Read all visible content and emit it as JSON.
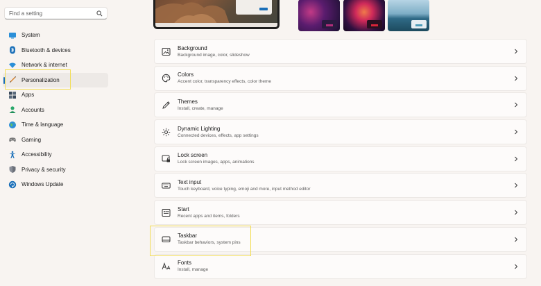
{
  "search": {
    "placeholder": "Find a setting"
  },
  "sidebar": {
    "items": [
      {
        "label": "System",
        "icon": "monitor-icon"
      },
      {
        "label": "Bluetooth & devices",
        "icon": "bluetooth-icon"
      },
      {
        "label": "Network & internet",
        "icon": "wifi-icon"
      },
      {
        "label": "Personalization",
        "icon": "brush-icon",
        "active": true
      },
      {
        "label": "Apps",
        "icon": "apps-icon"
      },
      {
        "label": "Accounts",
        "icon": "person-icon"
      },
      {
        "label": "Time & language",
        "icon": "globe-icon"
      },
      {
        "label": "Gaming",
        "icon": "gamepad-icon"
      },
      {
        "label": "Accessibility",
        "icon": "accessibility-icon"
      },
      {
        "label": "Privacy & security",
        "icon": "shield-icon"
      },
      {
        "label": "Windows Update",
        "icon": "update-icon"
      }
    ]
  },
  "cards": [
    {
      "title": "Background",
      "subtitle": "Background image, color, slideshow",
      "icon": "image-icon"
    },
    {
      "title": "Colors",
      "subtitle": "Accent color, transparency effects, color theme",
      "icon": "palette-icon"
    },
    {
      "title": "Themes",
      "subtitle": "Install, create, manage",
      "icon": "pen-icon"
    },
    {
      "title": "Dynamic Lighting",
      "subtitle": "Connected devices, effects, app settings",
      "icon": "lighting-icon"
    },
    {
      "title": "Lock screen",
      "subtitle": "Lock screen images, apps, animations",
      "icon": "lock-screen-icon"
    },
    {
      "title": "Text input",
      "subtitle": "Touch keyboard, voice typing, emoji and more, input method editor",
      "icon": "keyboard-icon"
    },
    {
      "title": "Start",
      "subtitle": "Recent apps and items, folders",
      "icon": "start-icon"
    },
    {
      "title": "Taskbar",
      "subtitle": "Taskbar behaviors, system pins",
      "icon": "taskbar-icon"
    },
    {
      "title": "Fonts",
      "subtitle": "Install, manage",
      "icon": "fonts-icon"
    }
  ],
  "colors": {
    "accent": "#1a6fb8",
    "highlight": "#f2dd54",
    "background": "#f8f4f1",
    "card": "#fdfbfa"
  }
}
